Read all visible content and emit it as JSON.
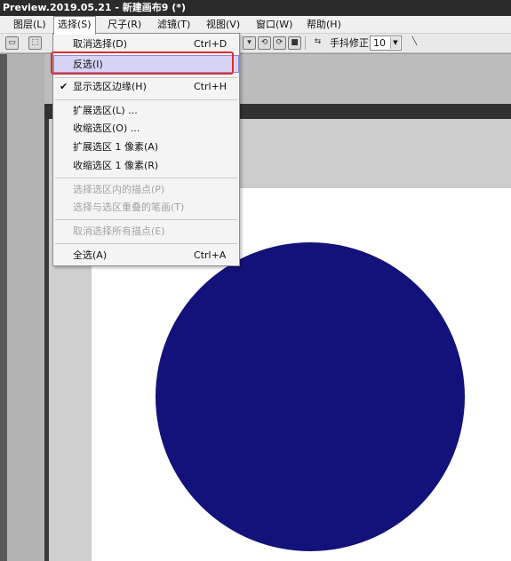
{
  "window": {
    "title": "Preview.2019.05.21 - 新建画布9 (*)"
  },
  "menubar": {
    "items": [
      {
        "label": "图层(L)"
      },
      {
        "label": "选择(S)"
      },
      {
        "label": "尺子(R)"
      },
      {
        "label": "滤镜(T)"
      },
      {
        "label": "视图(V)"
      },
      {
        "label": "窗口(W)"
      },
      {
        "label": "帮助(H)"
      }
    ]
  },
  "toolbar": {
    "stabilizer_label": "手抖修正",
    "stabilizer_value": "10"
  },
  "select_menu": {
    "items": [
      {
        "label": "取消选择(D)",
        "shortcut": "Ctrl+D"
      },
      {
        "label": "反选(I)",
        "shortcut": ""
      },
      {
        "label": "显示选区边缘(H)",
        "shortcut": "Ctrl+H",
        "checked_mark": "✔"
      },
      {
        "label": "扩展选区(L) ...",
        "shortcut": ""
      },
      {
        "label": "收缩选区(O) ...",
        "shortcut": ""
      },
      {
        "label": "扩展选区 1 像素(A)",
        "shortcut": ""
      },
      {
        "label": "收缩选区 1 像素(R)",
        "shortcut": ""
      },
      {
        "label": "选择选区内的描点(P)",
        "shortcut": ""
      },
      {
        "label": "选择与选区重叠的笔画(T)",
        "shortcut": ""
      },
      {
        "label": "取消选择所有描点(E)",
        "shortcut": ""
      },
      {
        "label": "全选(A)",
        "shortcut": "Ctrl+A"
      }
    ]
  },
  "canvas": {
    "shape_color": "#12127a",
    "background": "#ffffff"
  },
  "colors": {
    "highlight": "#d6d3f5",
    "annotation": "#e32c2c"
  }
}
